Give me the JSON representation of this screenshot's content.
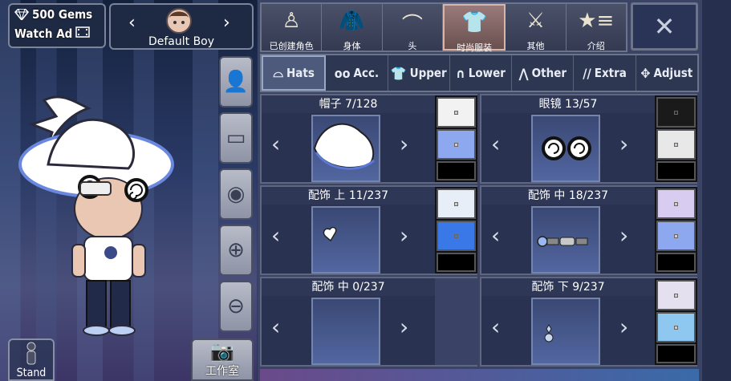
{
  "currency": {
    "gems_label": "500 Gems",
    "watch_ad_label": "Watch Ad"
  },
  "character": {
    "name": "Default Boy"
  },
  "stand_label": "Stand",
  "studio_label": "工作室",
  "categories": [
    {
      "label": "已创建角色",
      "icon": "person-silhouette-icon"
    },
    {
      "label": "身体",
      "icon": "jacket-icon"
    },
    {
      "label": "头",
      "icon": "hair-icon"
    },
    {
      "label": "时尚服装",
      "icon": "shirt-icon"
    },
    {
      "label": "其他",
      "icon": "sword-cat-icon"
    },
    {
      "label": "介绍",
      "icon": "star-list-icon"
    }
  ],
  "active_category": "时尚服装",
  "subtabs": [
    {
      "label": "Hats",
      "icon": "hat-icon"
    },
    {
      "label": "Acc.",
      "icon": "glasses-icon"
    },
    {
      "label": "Upper",
      "icon": "shirt-icon"
    },
    {
      "label": "Lower",
      "icon": "pants-icon"
    },
    {
      "label": "Other",
      "icon": "cape-icon"
    },
    {
      "label": "Extra",
      "icon": "slashes-icon"
    },
    {
      "label": "Adjust",
      "icon": "move-icon"
    }
  ],
  "active_subtab": "Hats",
  "slots": [
    {
      "title": "帽子 7/128",
      "swatches": [
        "#f2f2f2",
        "#8ea8f0",
        "#000000"
      ]
    },
    {
      "title": "眼镜 13/57",
      "swatches": [
        "#1a1a1a",
        "#e8e8e8",
        "#000000"
      ]
    },
    {
      "title": "配饰 上 11/237",
      "swatches": [
        "#e8eef8",
        "#3a78e8",
        "#000000"
      ]
    },
    {
      "title": "配饰 中 18/237",
      "swatches": [
        "#d8ccf0",
        "#8ea8f0",
        "#000000"
      ]
    },
    {
      "title": "配饰 中 0/237",
      "swatches": []
    },
    {
      "title": "配饰 下 9/237",
      "swatches": [
        "#e4e0f0",
        "#8ec8f0",
        "#000000"
      ]
    }
  ],
  "colors": {
    "active_tab": "#9a7a7a",
    "panel": "#2a3252"
  }
}
